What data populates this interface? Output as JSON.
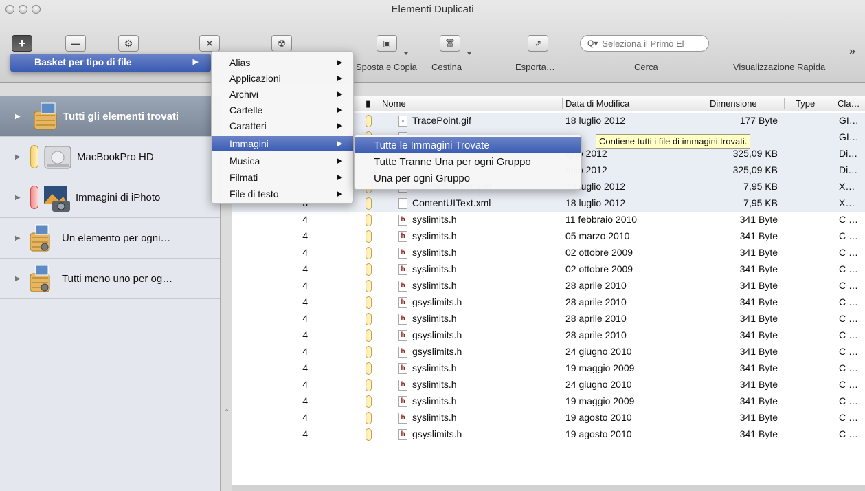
{
  "window": {
    "title": "Elementi Duplicati"
  },
  "toolbar": {
    "buttons": [
      {
        "name": "add",
        "icon": "plus-icon",
        "label": ""
      },
      {
        "name": "remove",
        "icon": "minus-icon",
        "label": ""
      },
      {
        "name": "settings",
        "icon": "gear-icon",
        "label": ""
      },
      {
        "name": "delete",
        "icon": "x-icon",
        "label": ""
      },
      {
        "name": "radiation",
        "icon": "radiation-icon",
        "label": ""
      }
    ],
    "move_copy_label": "Sposta e Copia",
    "trash_label": "Cestina",
    "export_label": "Esporta…",
    "search_label": "Cerca",
    "search_placeholder": "Seleziona il Primo El",
    "quicklook_label": "Visualizzazione Rapida"
  },
  "sidebar": {
    "items": [
      {
        "label": "Tutti gli elementi trovati",
        "icon": "basket-icon",
        "selected": true
      },
      {
        "label": "MacBookPro HD",
        "icon": "hard-drive-icon",
        "pill_color": "#f5d06a"
      },
      {
        "label": "Immagini di iPhoto",
        "icon": "iphoto-icon",
        "pill_color": "#f08b8b"
      },
      {
        "label": "Un elemento per ogni…",
        "icon": "basket-gear-icon"
      },
      {
        "label": "Tutti meno uno per og…",
        "icon": "basket-gear-icon"
      }
    ]
  },
  "table": {
    "columns": [
      "Nome",
      "Data di Modifica",
      "Dimensione",
      "Type",
      "Cla…"
    ],
    "rows": [
      {
        "group": "",
        "name": "TracePoint.gif",
        "file_type": "gif",
        "date": "18 luglio 2012",
        "size": "177 Byte",
        "cla": "GI…",
        "shaded": true
      },
      {
        "group": "",
        "name": "",
        "file_type": "gif",
        "date": "",
        "size": "",
        "cla": "GI…",
        "shaded": true
      },
      {
        "group": "",
        "name": "",
        "file_type": "plain",
        "date": "ıglio 2012",
        "size": "325,09 KB",
        "cla": "Di…",
        "shaded": true
      },
      {
        "group": "",
        "name": "",
        "file_type": "plain",
        "date": "ıglio 2012",
        "size": "325,09 KB",
        "cla": "Di…",
        "shaded": true
      },
      {
        "group": "",
        "name": "ContentUIText.xml",
        "file_type": "plain",
        "date": "18 luglio 2012",
        "size": "7,95 KB",
        "cla": "X…",
        "shaded": true
      },
      {
        "group": "3",
        "name": "ContentUIText.xml",
        "file_type": "plain",
        "date": "18 luglio 2012",
        "size": "7,95 KB",
        "cla": "X…",
        "shaded": true
      },
      {
        "group": "4",
        "name": "syslimits.h",
        "file_type": "h",
        "date": "11 febbraio 2010",
        "size": "341 Byte",
        "cla": "C …"
      },
      {
        "group": "4",
        "name": "syslimits.h",
        "file_type": "h",
        "date": "05 marzo 2010",
        "size": "341 Byte",
        "cla": "C …"
      },
      {
        "group": "4",
        "name": "syslimits.h",
        "file_type": "h",
        "date": "02 ottobre 2009",
        "size": "341 Byte",
        "cla": "C …"
      },
      {
        "group": "4",
        "name": "syslimits.h",
        "file_type": "h",
        "date": "02 ottobre 2009",
        "size": "341 Byte",
        "cla": "C …"
      },
      {
        "group": "4",
        "name": "syslimits.h",
        "file_type": "h",
        "date": "28 aprile 2010",
        "size": "341 Byte",
        "cla": "C …"
      },
      {
        "group": "4",
        "name": "gsyslimits.h",
        "file_type": "h",
        "date": "28 aprile 2010",
        "size": "341 Byte",
        "cla": "C …"
      },
      {
        "group": "4",
        "name": "syslimits.h",
        "file_type": "h",
        "date": "28 aprile 2010",
        "size": "341 Byte",
        "cla": "C …"
      },
      {
        "group": "4",
        "name": "gsyslimits.h",
        "file_type": "h",
        "date": "28 aprile 2010",
        "size": "341 Byte",
        "cla": "C …"
      },
      {
        "group": "4",
        "name": "gsyslimits.h",
        "file_type": "h",
        "date": "24 giugno 2010",
        "size": "341 Byte",
        "cla": "C …"
      },
      {
        "group": "4",
        "name": "syslimits.h",
        "file_type": "h",
        "date": "19 maggio 2009",
        "size": "341 Byte",
        "cla": "C …"
      },
      {
        "group": "4",
        "name": "syslimits.h",
        "file_type": "h",
        "date": "24 giugno 2010",
        "size": "341 Byte",
        "cla": "C …"
      },
      {
        "group": "4",
        "name": "syslimits.h",
        "file_type": "h",
        "date": "19 maggio 2009",
        "size": "341 Byte",
        "cla": "C …"
      },
      {
        "group": "4",
        "name": "syslimits.h",
        "file_type": "h",
        "date": "19 agosto 2010",
        "size": "341 Byte",
        "cla": "C …"
      },
      {
        "group": "4",
        "name": "gsyslimits.h",
        "file_type": "h",
        "date": "19 agosto 2010",
        "size": "341 Byte",
        "cla": "C …"
      }
    ]
  },
  "menus": {
    "basket_menu": {
      "label": "Basket per tipo di file"
    },
    "file_types": [
      {
        "label": "Alias"
      },
      {
        "label": "Applicazioni"
      },
      {
        "label": "Archivi"
      },
      {
        "label": "Cartelle"
      },
      {
        "label": "Caratteri"
      },
      {
        "label": "Immagini",
        "highlighted": true
      },
      {
        "label": "Musica"
      },
      {
        "label": "Filmati"
      },
      {
        "label": "File di testo"
      }
    ],
    "images_submenu": [
      {
        "label": "Tutte le Immagini Trovate",
        "highlighted": true
      },
      {
        "label": "Tutte Tranne Una per ogni Gruppo"
      },
      {
        "label": "Una per ogni Gruppo"
      }
    ]
  },
  "tooltip": {
    "text": "Contiene tutti i file di immagini trovati."
  },
  "colors": {
    "menu_highlight": "#3a5cb3",
    "sidebar_selected": "#8a96a6",
    "tooltip_bg": "#ffffc6",
    "row_shade": "#e9eef4"
  }
}
